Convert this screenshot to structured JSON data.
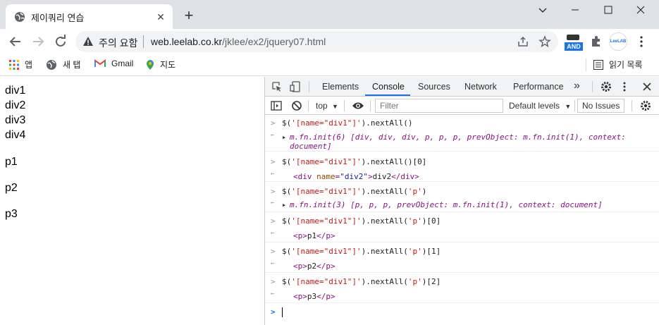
{
  "browser": {
    "tab_title": "제이쿼리 연습",
    "security_label": "주의 요함",
    "url_host": "web.leelab.co.kr",
    "url_path": "/jklee/ex2/jquery07.html",
    "and_badge": "AND",
    "leelab_badge": "LeeLAB",
    "bookmarks": [
      "앱",
      "새 탭",
      "Gmail",
      "지도"
    ],
    "reading_list": "읽기 목록"
  },
  "page": {
    "lines": [
      "div1",
      "div2",
      "div3",
      "div4",
      "p1",
      "p2",
      "p3"
    ]
  },
  "devtools": {
    "tabs": [
      "Elements",
      "Console",
      "Sources",
      "Network",
      "Performance"
    ],
    "more_tabs": "»",
    "context": "top",
    "filter_placeholder": "Filter",
    "default_levels": "Default levels",
    "no_issues": "No Issues",
    "entries": [
      {
        "cmd_prefix": "$(",
        "cmd_str": "'[name=\"div1\"]'",
        "cmd_suffix": ").nextAll()",
        "res_line1": "m.fn.init(6) [div, div, div, p, p, p, prevObject: m.fn.init(1), context:",
        "res_line2": "document]"
      },
      {
        "cmd_prefix": "$(",
        "cmd_str": "'[name=\"div1\"]'",
        "cmd_suffix": ").nextAll()[0]",
        "res_tag_open": "<div",
        "res_attr_name": "name",
        "res_attr_eq": "=",
        "res_attr_val": "\"div2\"",
        "res_tag_close": ">",
        "res_text": "div2",
        "res_end_tag": "</div>"
      },
      {
        "cmd_prefix": "$(",
        "cmd_str": "'[name=\"div1\"]'",
        "cmd_mid": ").nextAll(",
        "cmd_arg": "'p'",
        "cmd_suffix": ")",
        "res_line1": "m.fn.init(3) [p, p, p, prevObject: m.fn.init(1), context: document]"
      },
      {
        "cmd_prefix": "$(",
        "cmd_str": "'[name=\"div1\"]'",
        "cmd_mid": ").nextAll(",
        "cmd_arg": "'p'",
        "cmd_suffix": ")[0]",
        "res_open": "<p>",
        "res_text": "p1",
        "res_close": "</p>"
      },
      {
        "cmd_prefix": "$(",
        "cmd_str": "'[name=\"div1\"]'",
        "cmd_mid": ").nextAll(",
        "cmd_arg": "'p'",
        "cmd_suffix": ")[1]",
        "res_open": "<p>",
        "res_text": "p2",
        "res_close": "</p>"
      },
      {
        "cmd_prefix": "$(",
        "cmd_str": "'[name=\"div1\"]'",
        "cmd_mid": ").nextAll(",
        "cmd_arg": "'p'",
        "cmd_suffix": ")[2]",
        "res_open": "<p>",
        "res_text": "p3",
        "res_close": "</p>"
      }
    ]
  },
  "icons": {
    "prompt": ">",
    "result": "←",
    "expand": "▶",
    "dropdown": "▼",
    "input_prompt": ">"
  },
  "colors": {
    "accent": "#1a73e8",
    "string": "#c41a16",
    "object": "#881280",
    "attr_name": "#994500",
    "attr_value": "#1a1aa6"
  }
}
